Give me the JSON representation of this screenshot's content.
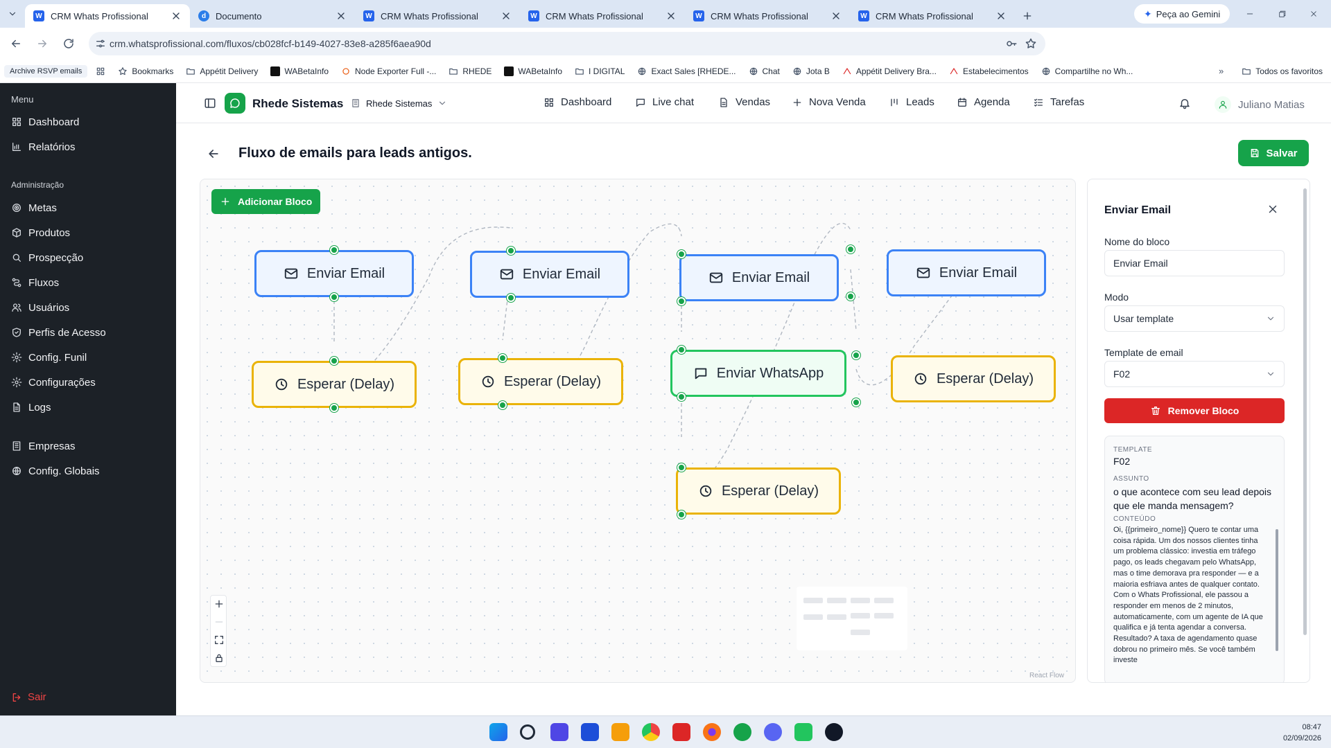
{
  "browser": {
    "tabs": [
      {
        "title": "CRM Whats Profissional",
        "active": true
      },
      {
        "title": "Documento",
        "active": false
      },
      {
        "title": "CRM Whats Profissional",
        "active": false
      },
      {
        "title": "CRM Whats Profissional",
        "active": false
      },
      {
        "title": "CRM Whats Profissional",
        "active": false
      },
      {
        "title": "CRM Whats Profissional",
        "active": false
      }
    ],
    "gemini_label": "Peça ao Gemini",
    "url": "crm.whatsprofissional.com/fluxos/cb028fcf-b149-4027-83e8-a285f6aea90d",
    "bookmarks": [
      "Archive RSVP emails",
      "Bookmarks",
      "Appétit Delivery",
      "WABetaInfo",
      "Node Exporter Full -...",
      "RHEDE",
      "WABetaInfo",
      "I DIGITAL",
      "Exact Sales [RHEDE...",
      "Chat",
      "Jota B",
      "Appétit Delivery Bra...",
      "Estabelecimentos",
      "Compartilhe no Wh..."
    ],
    "bookmarks_all": "Todos os favoritos"
  },
  "sidebar": {
    "menu_heading": "Menu",
    "menu_items": [
      {
        "label": "Dashboard",
        "icon": "grid-icon"
      },
      {
        "label": "Relatórios",
        "icon": "bar-chart-icon"
      }
    ],
    "admin_heading": "Administração",
    "admin_items": [
      {
        "label": "Metas",
        "icon": "target-icon"
      },
      {
        "label": "Produtos",
        "icon": "package-icon"
      },
      {
        "label": "Prospecção",
        "icon": "search-icon"
      },
      {
        "label": "Fluxos",
        "icon": "workflow-icon"
      },
      {
        "label": "Usuários",
        "icon": "users-icon"
      },
      {
        "label": "Perfis de Acesso",
        "icon": "shield-icon"
      },
      {
        "label": "Config. Funil",
        "icon": "funnel-icon"
      },
      {
        "label": "Configurações",
        "icon": "gear-icon"
      },
      {
        "label": "Logs",
        "icon": "file-icon"
      }
    ],
    "global_items": [
      {
        "label": "Empresas",
        "icon": "building-icon"
      },
      {
        "label": "Config. Globais",
        "icon": "globe-icon"
      }
    ],
    "logout_label": "Sair"
  },
  "appbar": {
    "brand": "Rhede Sistemas",
    "company_select": "Rhede Sistemas",
    "nav": [
      {
        "label": "Dashboard",
        "icon": "grid-icon"
      },
      {
        "label": "Live chat",
        "icon": "chat-icon"
      },
      {
        "label": "Vendas",
        "icon": "document-icon"
      },
      {
        "label": "Nova Venda",
        "icon": "plus-icon"
      },
      {
        "label": "Leads",
        "icon": "columns-icon"
      },
      {
        "label": "Agenda",
        "icon": "calendar-icon"
      },
      {
        "label": "Tarefas",
        "icon": "checklist-icon"
      }
    ],
    "user_name": "Juliano Matias"
  },
  "page": {
    "title": "Fluxo de emails para leads antigos.",
    "save_label": "Salvar"
  },
  "canvas": {
    "add_block_label": "Adicionar Bloco",
    "nodes": [
      {
        "type": "email",
        "label": "Enviar Email"
      },
      {
        "type": "email",
        "label": "Enviar Email"
      },
      {
        "type": "email",
        "label": "Enviar Email"
      },
      {
        "type": "email",
        "label": "Enviar Email"
      },
      {
        "type": "delay",
        "label": "Esperar (Delay)"
      },
      {
        "type": "delay",
        "label": "Esperar (Delay)"
      },
      {
        "type": "whatsapp",
        "label": "Enviar WhatsApp"
      },
      {
        "type": "delay",
        "label": "Esperar (Delay)"
      },
      {
        "type": "delay",
        "label": "Esperar (Delay)"
      }
    ],
    "attribution": "React Flow"
  },
  "panel": {
    "title": "Enviar Email",
    "block_name_label": "Nome do bloco",
    "block_name_value": "Enviar Email",
    "mode_label": "Modo",
    "mode_value": "Usar template",
    "template_label": "Template de email",
    "template_value": "F02",
    "remove_label": "Remover Bloco",
    "preview": {
      "template_heading": "TEMPLATE",
      "template_value": "F02",
      "subject_heading": "ASSUNTO",
      "subject_value": "o que acontece com seu lead depois que ele manda mensagem?",
      "content_heading": "CONTEÚDO",
      "content_value": "Oi, {{primeiro_nome}} Quero te contar uma coisa rápida. Um dos nossos clientes tinha um problema clássico: investia em tráfego pago, os leads chegavam pelo WhatsApp, mas o time demorava pra responder — e a maioria esfriava antes de qualquer contato. Com o Whats Profissional, ele passou a responder em menos de 2 minutos, automaticamente, com um agente de IA que qualifica e já tenta agendar a conversa. Resultado? A taxa de agendamento quase dobrou no primeiro mês. Se você também investe"
    }
  },
  "taskbar": {
    "time": "08:47",
    "date": "02/09/2026"
  }
}
